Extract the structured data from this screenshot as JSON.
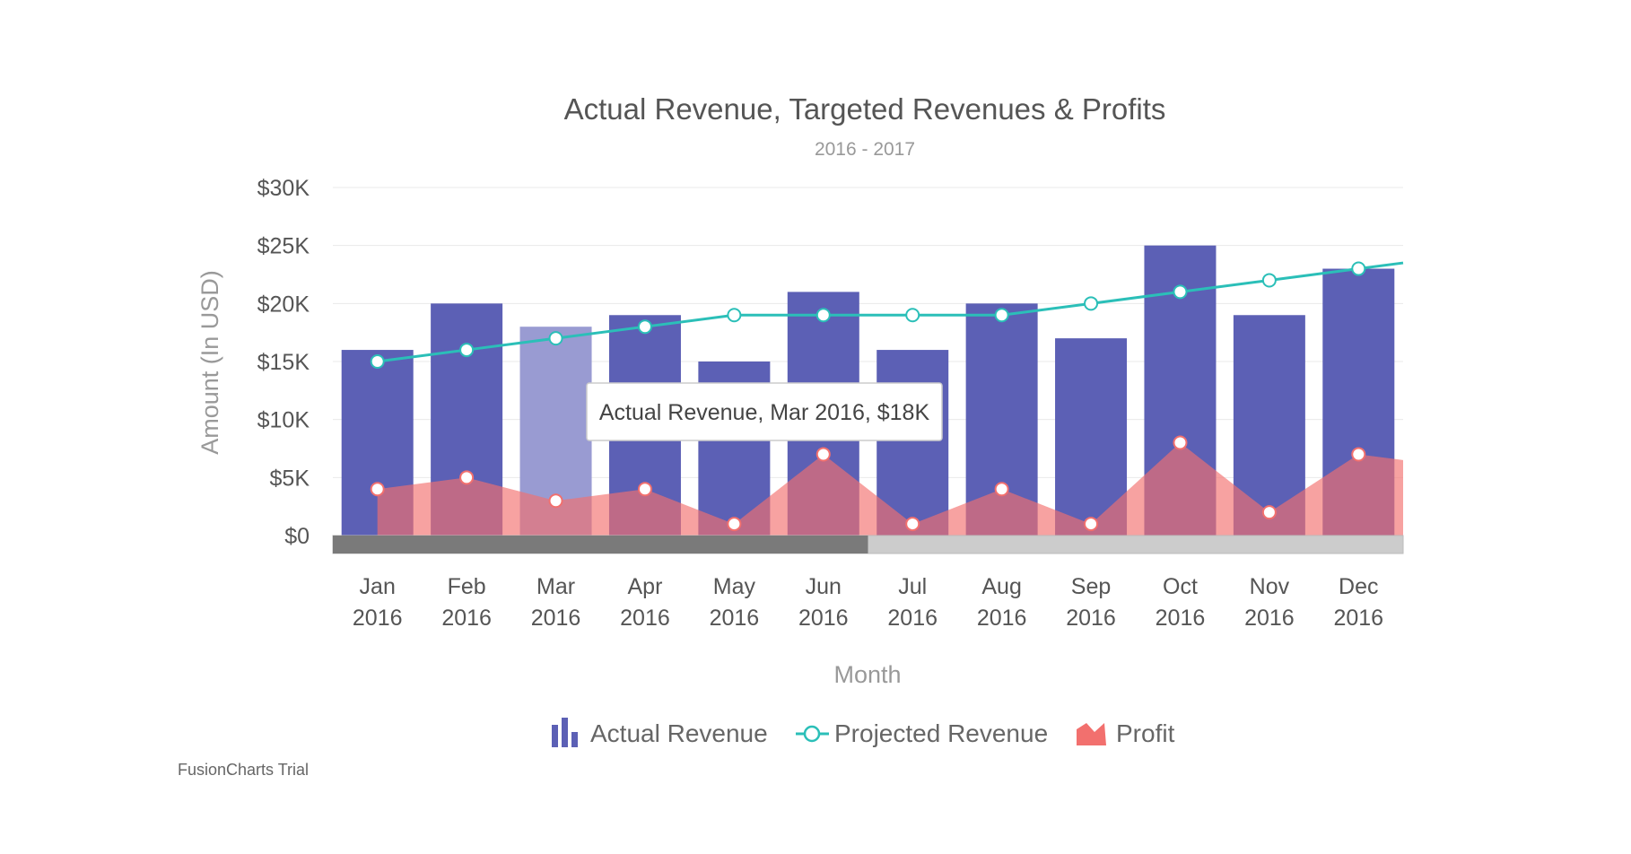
{
  "chart_data": {
    "type": "bar",
    "title": "Actual Revenue, Targeted Revenues & Profits",
    "subtitle": "2016 - 2017",
    "xlabel": "Month",
    "ylabel": "Amount (In USD)",
    "ylim": [
      0,
      30000
    ],
    "yticks": [
      {
        "value": 0,
        "label": "$0"
      },
      {
        "value": 5000,
        "label": "$5K"
      },
      {
        "value": 10000,
        "label": "$10K"
      },
      {
        "value": 15000,
        "label": "$15K"
      },
      {
        "value": 20000,
        "label": "$20K"
      },
      {
        "value": 25000,
        "label": "$25K"
      },
      {
        "value": 30000,
        "label": "$30K"
      }
    ],
    "categories": [
      {
        "month": "Jan",
        "year": "2016"
      },
      {
        "month": "Feb",
        "year": "2016"
      },
      {
        "month": "Mar",
        "year": "2016"
      },
      {
        "month": "Apr",
        "year": "2016"
      },
      {
        "month": "May",
        "year": "2016"
      },
      {
        "month": "Jun",
        "year": "2016"
      },
      {
        "month": "Jul",
        "year": "2016"
      },
      {
        "month": "Aug",
        "year": "2016"
      },
      {
        "month": "Sep",
        "year": "2016"
      },
      {
        "month": "Oct",
        "year": "2016"
      },
      {
        "month": "Nov",
        "year": "2016"
      },
      {
        "month": "Dec",
        "year": "2016"
      }
    ],
    "series": [
      {
        "name": "Actual Revenue",
        "type": "bar",
        "color": "#5c60b5",
        "values": [
          16000,
          20000,
          18000,
          19000,
          15000,
          21000,
          16000,
          20000,
          17000,
          25000,
          19000,
          23000
        ]
      },
      {
        "name": "Projected Revenue",
        "type": "line",
        "color": "#2bbfb8",
        "values": [
          15000,
          16000,
          17000,
          18000,
          19000,
          19000,
          19000,
          19000,
          20000,
          21000,
          22000,
          23000
        ],
        "continues_to": 23500
      },
      {
        "name": "Profit",
        "type": "area",
        "color": "#f2706e",
        "values": [
          4000,
          5000,
          3000,
          4000,
          1000,
          7000,
          1000,
          4000,
          1000,
          8000,
          2000,
          7000
        ],
        "continues_to": 6500
      }
    ],
    "highlighted_bar_color": "#999bd2",
    "highlighted_index": 2,
    "tooltip": "Actual Revenue, Mar 2016, $18K",
    "legend_position": "bottom",
    "grid": true,
    "scroll_position": 0.5
  },
  "watermark": "FusionCharts Trial"
}
